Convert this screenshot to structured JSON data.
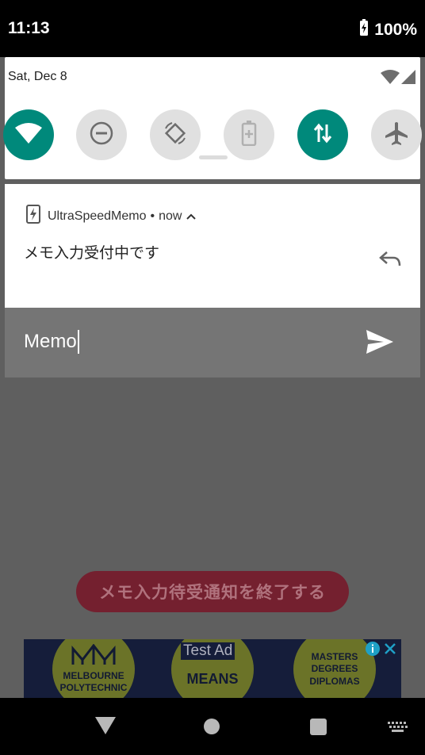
{
  "status_bar": {
    "time": "11:13",
    "battery": "100%"
  },
  "quick_settings": {
    "date": "Sat, Dec 8",
    "tiles": [
      {
        "name": "wifi-icon",
        "active": true
      },
      {
        "name": "do-not-disturb-icon",
        "active": false
      },
      {
        "name": "auto-rotate-icon",
        "active": false
      },
      {
        "name": "battery-saver-icon",
        "active": false
      },
      {
        "name": "mobile-data-icon",
        "active": true
      },
      {
        "name": "airplane-mode-icon",
        "active": false
      }
    ]
  },
  "notification": {
    "app_name": "UltraSpeedMemo",
    "separator": "•",
    "time": "now",
    "text": "メモ入力受付中です"
  },
  "reply": {
    "value": "Memo"
  },
  "app": {
    "end_button_label": "メモ入力待受通知を終了する"
  },
  "ad": {
    "label": "Test Ad",
    "circle_left_line1": "MELBOURNE",
    "circle_left_line2": "POLYTECHNIC",
    "circle_mid": "MEANS",
    "circle_right_line1": "MASTERS",
    "circle_right_line2": "DEGREES",
    "circle_right_line3": "DIPLOMAS"
  },
  "colors": {
    "accent": "#00897b",
    "button": "#74202f"
  }
}
